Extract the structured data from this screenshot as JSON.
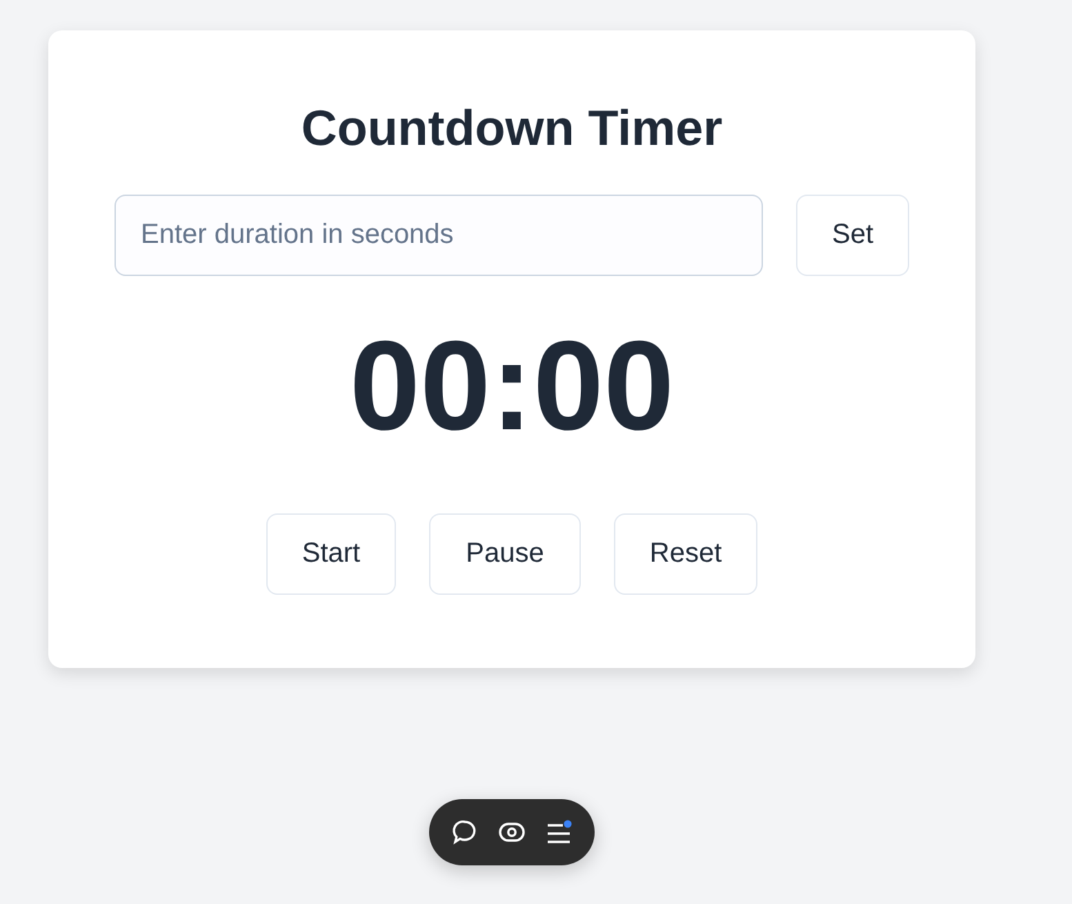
{
  "title": "Countdown Timer",
  "duration_input": {
    "placeholder": "Enter duration in seconds"
  },
  "set_button": "Set",
  "time_display": "00:00",
  "controls": [
    "Start",
    "Pause",
    "Reset"
  ]
}
